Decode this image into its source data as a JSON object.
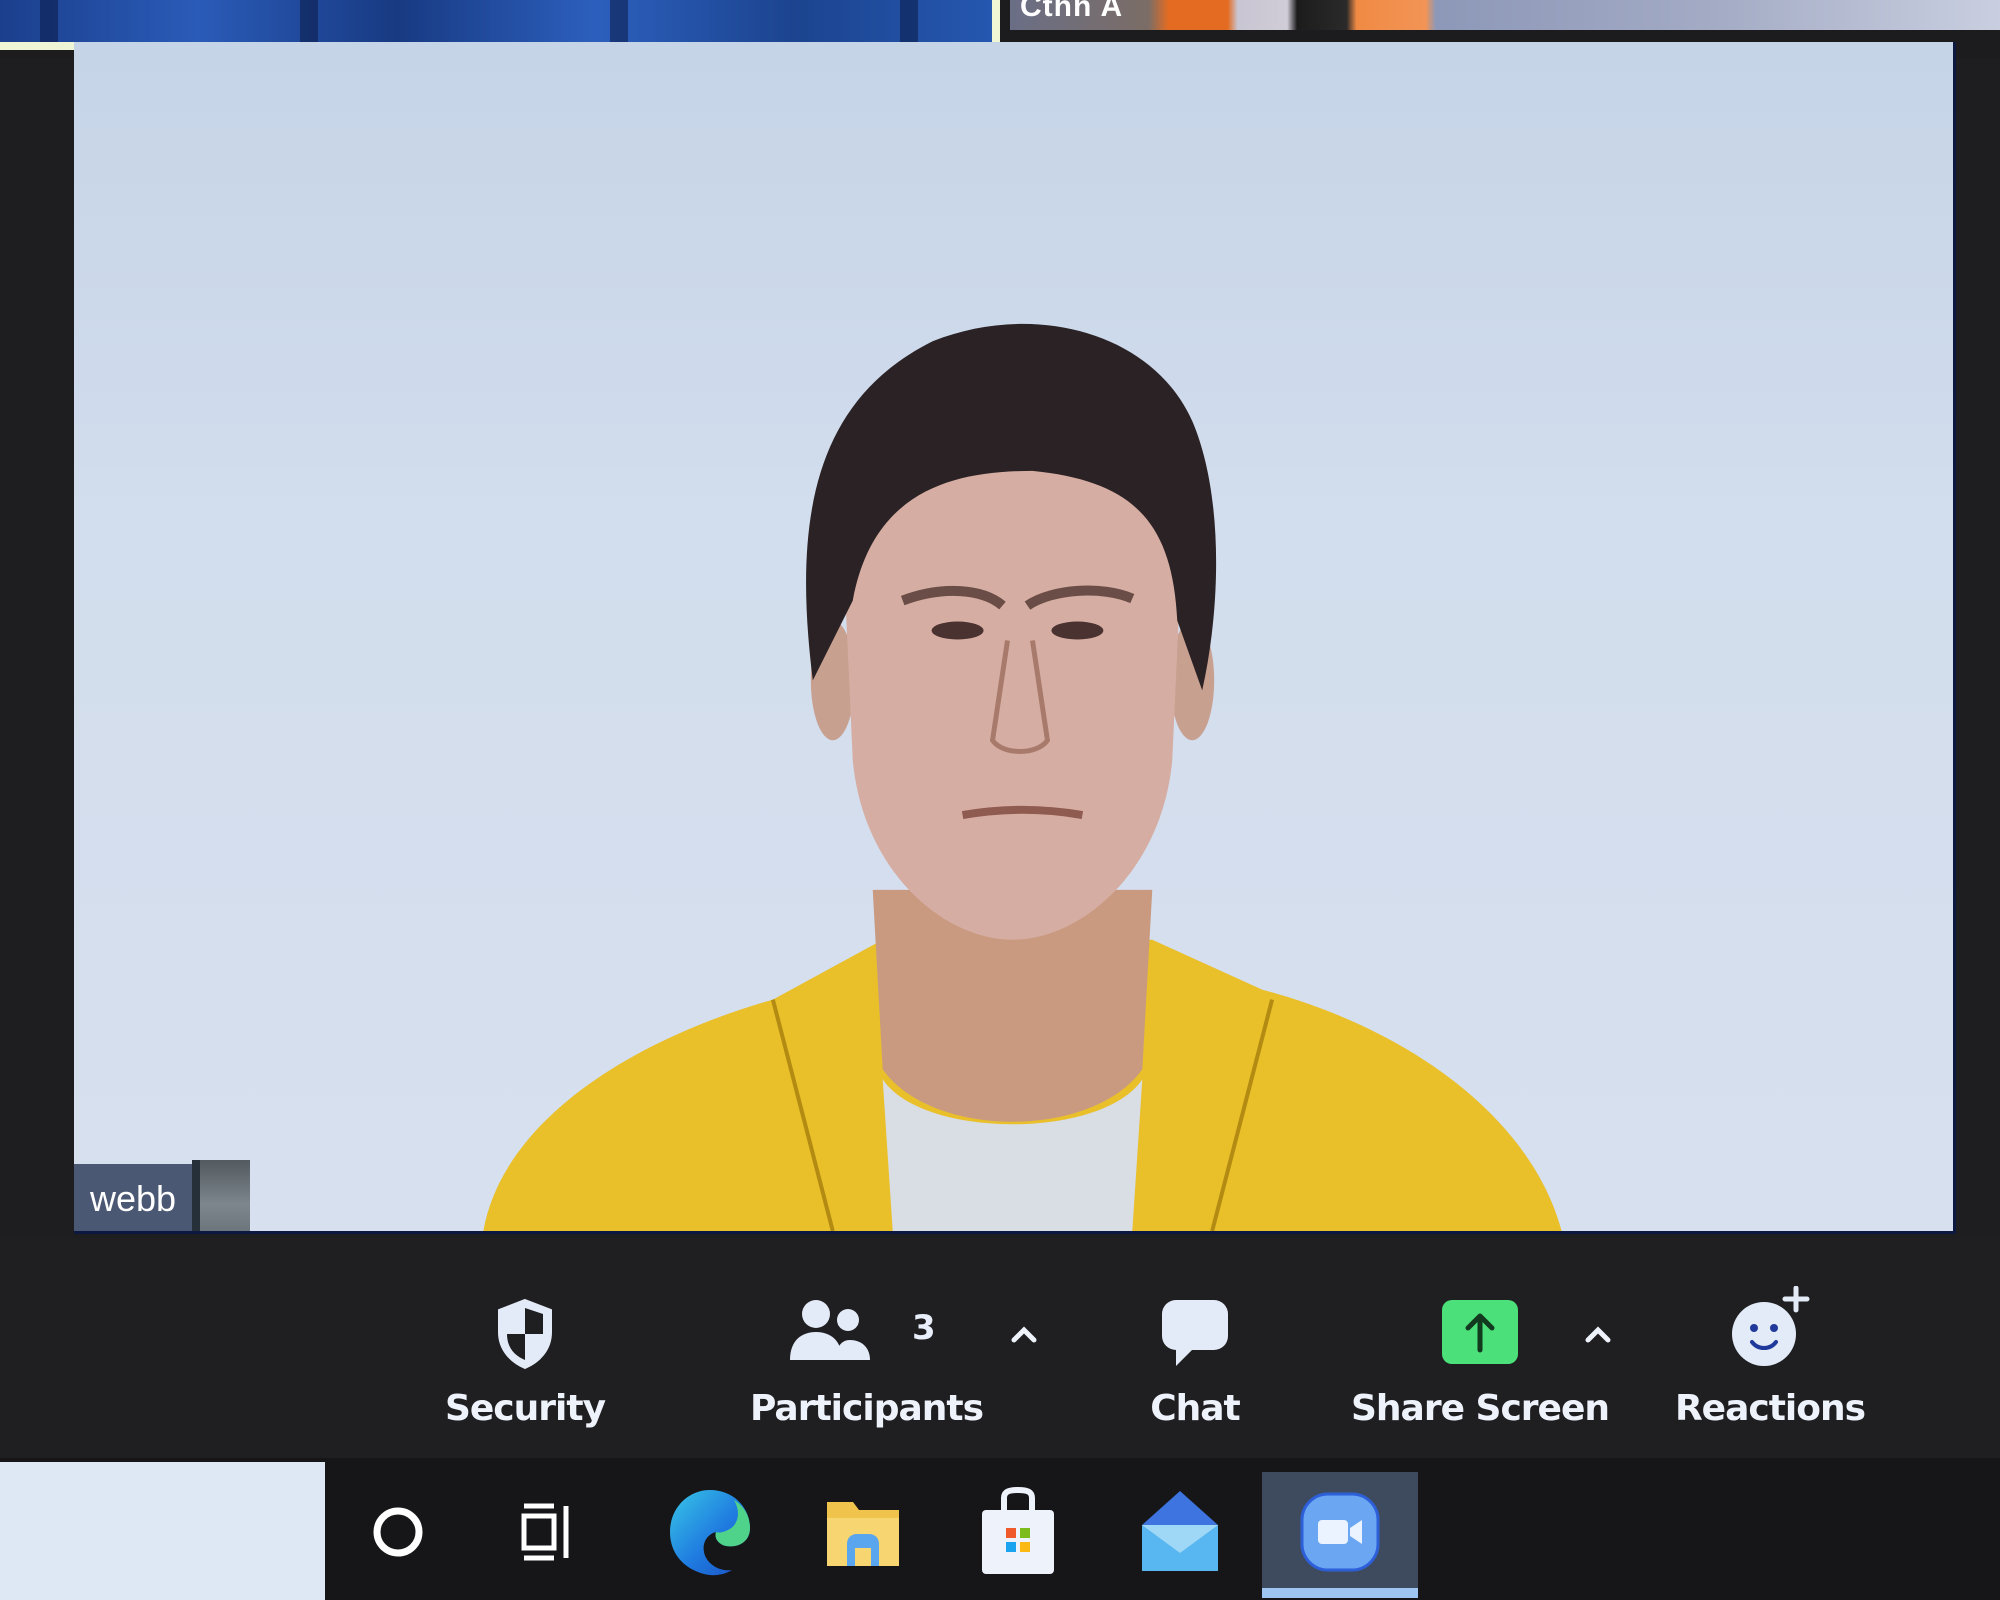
{
  "meeting": {
    "thumbnails": [
      {
        "name": "",
        "active_speaker": true
      },
      {
        "name": "Cthh A",
        "active_speaker": false
      }
    ],
    "main_video": {
      "participant_name": "webb"
    }
  },
  "toolbar": {
    "items": [
      {
        "id": "security",
        "label": "Security",
        "icon": "shield-icon"
      },
      {
        "id": "participants",
        "label": "Participants",
        "icon": "participants-icon",
        "count": "3",
        "has_menu": true
      },
      {
        "id": "chat",
        "label": "Chat",
        "icon": "chat-bubble-icon"
      },
      {
        "id": "share",
        "label": "Share Screen",
        "icon": "share-screen-icon",
        "has_menu": true
      },
      {
        "id": "reactions",
        "label": "Reactions",
        "icon": "reactions-icon"
      }
    ],
    "share_color": "#4be07a"
  },
  "taskbar": {
    "search_placeholder": "",
    "apps": [
      {
        "id": "cortana",
        "icon": "cortana-circle-icon",
        "active": false
      },
      {
        "id": "task-view",
        "icon": "task-view-icon",
        "active": false
      },
      {
        "id": "edge",
        "icon": "edge-browser-icon",
        "active": false
      },
      {
        "id": "file-explorer",
        "icon": "file-explorer-icon",
        "active": false
      },
      {
        "id": "store",
        "icon": "microsoft-store-icon",
        "active": false
      },
      {
        "id": "mail",
        "icon": "mail-icon",
        "active": false
      },
      {
        "id": "zoom",
        "icon": "zoom-camera-icon",
        "active": true
      }
    ]
  }
}
